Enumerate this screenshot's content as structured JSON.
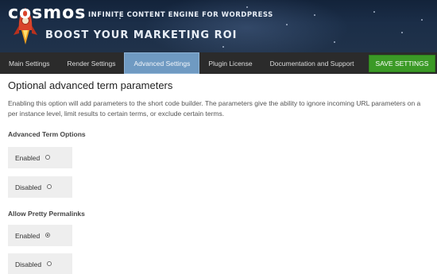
{
  "header": {
    "logo_text": "cosmos",
    "tagline": "INFINITE CONTENT ENGINE FOR WORDPRESS",
    "headline": "BOOST YOUR MARKETING ROI"
  },
  "nav": {
    "tabs": [
      {
        "label": "Main Settings",
        "active": false
      },
      {
        "label": "Render Settings",
        "active": false
      },
      {
        "label": "Advanced Settings",
        "active": true
      },
      {
        "label": "Plugin License",
        "active": false
      },
      {
        "label": "Documentation and Support",
        "active": false
      }
    ],
    "save_label": "SAVE SETTINGS"
  },
  "main": {
    "title": "Optional advanced term parameters",
    "description": "Enabling this option will add parameters to the short code builder. The parameters give the ability to ignore incoming URL parameters on a per instance level, limit results to certain terms, or exclude certain terms.",
    "groups": [
      {
        "label": "Advanced Term Options",
        "options": [
          {
            "label": "Enabled",
            "checked": false
          },
          {
            "label": "Disabled",
            "checked": false
          }
        ]
      },
      {
        "label": "Allow Pretty Permalinks",
        "options": [
          {
            "label": "Enabled",
            "checked": true
          },
          {
            "label": "Disabled",
            "checked": false
          }
        ]
      }
    ]
  },
  "colors": {
    "nav_bg": "#2b2b2b",
    "nav_active": "#6f9ac2",
    "save_button": "#3b9a26",
    "radio_bg": "#eeeeee"
  }
}
